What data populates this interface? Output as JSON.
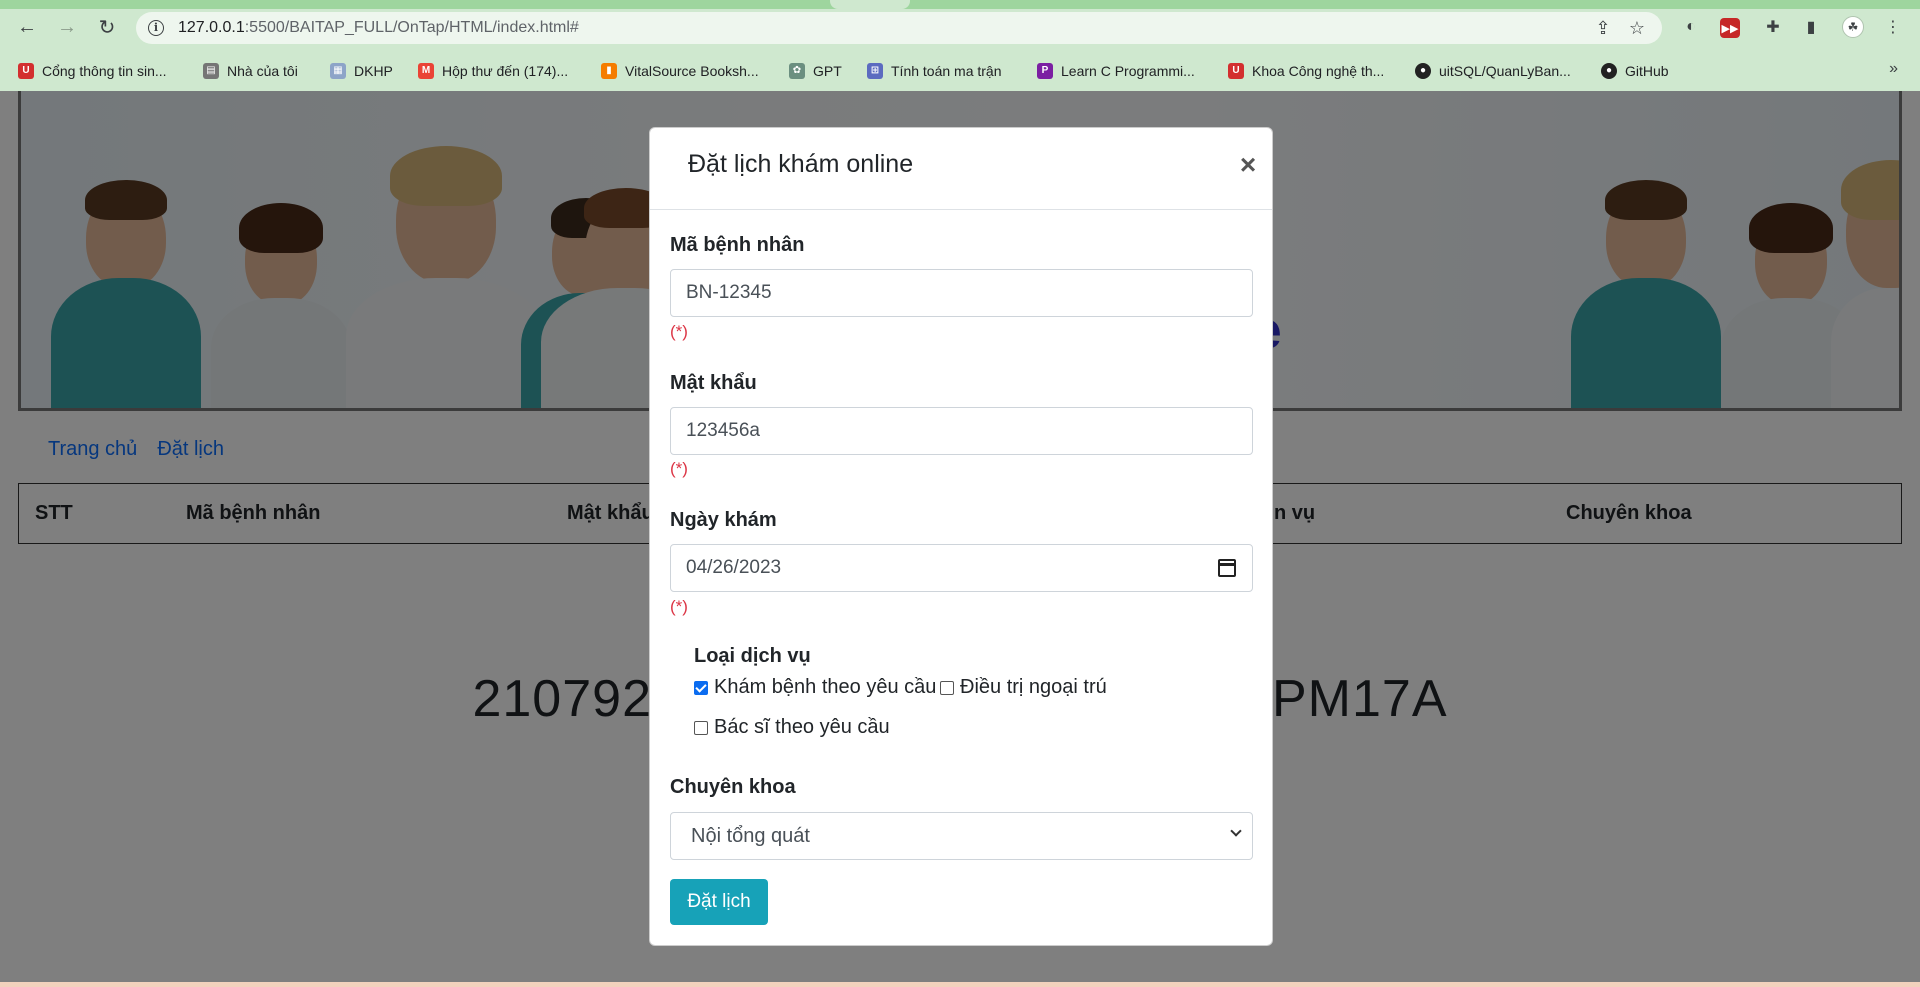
{
  "browser": {
    "url_host": "127.0.0.1",
    "url_path": ":5500/BAITAP_FULL/OnTap/HTML/index.html#",
    "bookmarks": [
      {
        "label": "Cổng thông tin sin...",
        "icon": "uit-icon",
        "color": "#d32f2f"
      },
      {
        "label": "Nhà của tôi",
        "icon": "page-icon",
        "color": "#757575"
      },
      {
        "label": "DKHP",
        "icon": "doc-icon",
        "color": "#8da4c8"
      },
      {
        "label": "Hộp thư đến (174)...",
        "icon": "gmail-icon",
        "color": "#ea4335"
      },
      {
        "label": "VitalSource Booksh...",
        "icon": "vitalsource-icon",
        "color": "#f57c00"
      },
      {
        "label": "GPT",
        "icon": "openai-icon",
        "color": "#6b8f80"
      },
      {
        "label": "Tính toán ma trận",
        "icon": "matrix-icon",
        "color": "#5c6bc0"
      },
      {
        "label": "Learn C Programmi...",
        "icon": "learnc-icon",
        "color": "#7b1fa2"
      },
      {
        "label": "Khoa Công nghệ th...",
        "icon": "uit-icon",
        "color": "#d32f2f"
      },
      {
        "label": "uitSQL/QuanLyBan...",
        "icon": "github-icon",
        "color": "#222222"
      },
      {
        "label": "GitHub",
        "icon": "github-icon",
        "color": "#222222"
      }
    ]
  },
  "page": {
    "banner_title": "ne",
    "nav": {
      "home": "Trang chủ",
      "booking": "Đặt lịch"
    },
    "table_headers": [
      "STT",
      "Mã bệnh nhân",
      "Mật khẩu",
      "n vụ",
      "Chuyên khoa"
    ],
    "footer_left": "210792",
    "footer_right": "PM17A"
  },
  "modal": {
    "title": "Đặt lịch khám online",
    "close_symbol": "×",
    "fields": {
      "patient_id": {
        "label": "Mã bệnh nhân",
        "value": "BN-12345",
        "required": "(*)"
      },
      "password": {
        "label": "Mật khẩu",
        "value": "123456a",
        "required": "(*)"
      },
      "date": {
        "label": "Ngày khám",
        "value": "04/26/2023",
        "required": "(*)"
      }
    },
    "service": {
      "label": "Loại dịch vụ",
      "options": [
        {
          "label": "Khám bệnh theo yêu cầu",
          "checked": true
        },
        {
          "label": "Điều trị ngoại trú",
          "checked": false
        },
        {
          "label": "Bác sĩ theo yêu cầu",
          "checked": false
        }
      ]
    },
    "specialty": {
      "label": "Chuyên khoa",
      "selected": "Nội tổng quát"
    },
    "submit_label": "Đặt lịch"
  }
}
